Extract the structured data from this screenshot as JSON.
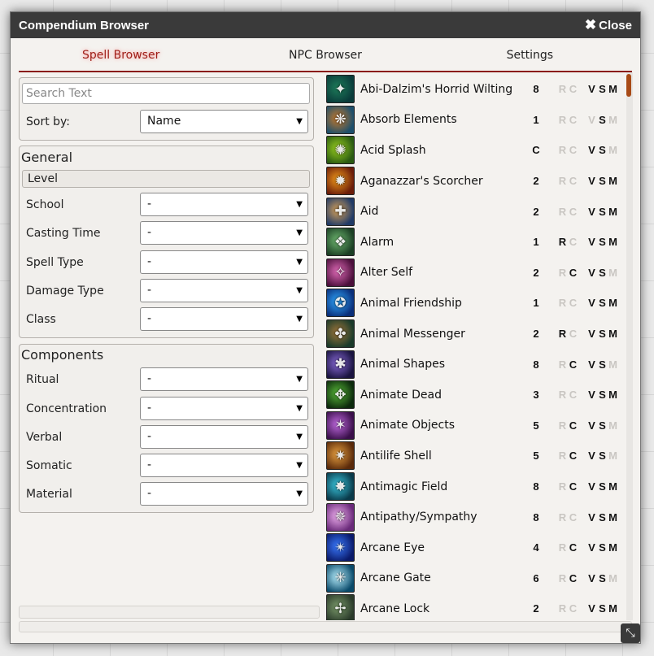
{
  "window": {
    "title": "Compendium Browser",
    "close_label": "Close"
  },
  "tabs": [
    {
      "label": "Spell Browser",
      "active": true
    },
    {
      "label": "NPC Browser",
      "active": false
    },
    {
      "label": "Settings",
      "active": false
    }
  ],
  "search": {
    "placeholder": "Search Text",
    "value": ""
  },
  "sort": {
    "label": "Sort by:",
    "value": "Name"
  },
  "general": {
    "legend": "General",
    "level_label": "Level",
    "filters": [
      {
        "label": "School",
        "value": "-"
      },
      {
        "label": "Casting Time",
        "value": "-"
      },
      {
        "label": "Spell Type",
        "value": "-"
      },
      {
        "label": "Damage Type",
        "value": "-"
      },
      {
        "label": "Class",
        "value": "-"
      }
    ]
  },
  "components": {
    "legend": "Components",
    "filters": [
      {
        "label": "Ritual",
        "value": "-"
      },
      {
        "label": "Concentration",
        "value": "-"
      },
      {
        "label": "Verbal",
        "value": "-"
      },
      {
        "label": "Somatic",
        "value": "-"
      },
      {
        "label": "Material",
        "value": "-"
      }
    ]
  },
  "spells": [
    {
      "name": "Abi-Dalzim's Horrid Wilting",
      "level": "8",
      "r": false,
      "c": false,
      "v": true,
      "s": true,
      "m": true,
      "colors": [
        "#0a3b3a",
        "#1e7d5a"
      ]
    },
    {
      "name": "Absorb Elements",
      "level": "1",
      "r": false,
      "c": false,
      "v": false,
      "s": true,
      "m": false,
      "colors": [
        "#1d4f6b",
        "#c97a2a"
      ]
    },
    {
      "name": "Acid Splash",
      "level": "C",
      "r": false,
      "c": false,
      "v": true,
      "s": true,
      "m": false,
      "colors": [
        "#2a5a12",
        "#9ad01e"
      ]
    },
    {
      "name": "Aganazzar's Scorcher",
      "level": "2",
      "r": false,
      "c": false,
      "v": true,
      "s": true,
      "m": true,
      "colors": [
        "#6b1d0a",
        "#f29a1a"
      ]
    },
    {
      "name": "Aid",
      "level": "2",
      "r": false,
      "c": false,
      "v": true,
      "s": true,
      "m": true,
      "colors": [
        "#203a66",
        "#d9a35a"
      ]
    },
    {
      "name": "Alarm",
      "level": "1",
      "r": true,
      "c": false,
      "v": true,
      "s": true,
      "m": true,
      "colors": [
        "#1b3f24",
        "#6fb870"
      ]
    },
    {
      "name": "Alter Self",
      "level": "2",
      "r": false,
      "c": true,
      "v": true,
      "s": true,
      "m": false,
      "colors": [
        "#4a0f3a",
        "#e06ab8"
      ]
    },
    {
      "name": "Animal Friendship",
      "level": "1",
      "r": false,
      "c": false,
      "v": true,
      "s": true,
      "m": true,
      "colors": [
        "#0a2f7a",
        "#2fa8ff"
      ]
    },
    {
      "name": "Animal Messenger",
      "level": "2",
      "r": true,
      "c": false,
      "v": true,
      "s": true,
      "m": true,
      "colors": [
        "#1a3a2a",
        "#a0763a"
      ]
    },
    {
      "name": "Animal Shapes",
      "level": "8",
      "r": false,
      "c": true,
      "v": true,
      "s": true,
      "m": false,
      "colors": [
        "#1a1440",
        "#8a6ad8"
      ]
    },
    {
      "name": "Animate Dead",
      "level": "3",
      "r": false,
      "c": false,
      "v": true,
      "s": true,
      "m": true,
      "colors": [
        "#0c2a0c",
        "#58b838"
      ]
    },
    {
      "name": "Animate Objects",
      "level": "5",
      "r": false,
      "c": true,
      "v": true,
      "s": true,
      "m": false,
      "colors": [
        "#3a0f4a",
        "#c06ae0"
      ]
    },
    {
      "name": "Antilife Shell",
      "level": "5",
      "r": false,
      "c": true,
      "v": true,
      "s": true,
      "m": false,
      "colors": [
        "#5a2a0a",
        "#e8a040"
      ]
    },
    {
      "name": "Antimagic Field",
      "level": "8",
      "r": false,
      "c": true,
      "v": true,
      "s": true,
      "m": true,
      "colors": [
        "#0a3a4a",
        "#3ac8e0"
      ]
    },
    {
      "name": "Antipathy/Sympathy",
      "level": "8",
      "r": false,
      "c": false,
      "v": true,
      "s": true,
      "m": true,
      "colors": [
        "#6a2a7a",
        "#f0b0f0"
      ]
    },
    {
      "name": "Arcane Eye",
      "level": "4",
      "r": false,
      "c": true,
      "v": true,
      "s": true,
      "m": true,
      "colors": [
        "#0a1a6a",
        "#3a7aff"
      ]
    },
    {
      "name": "Arcane Gate",
      "level": "6",
      "r": false,
      "c": true,
      "v": true,
      "s": true,
      "m": false,
      "colors": [
        "#0a4a6a",
        "#b8f0ff"
      ]
    },
    {
      "name": "Arcane Lock",
      "level": "2",
      "r": false,
      "c": false,
      "v": true,
      "s": true,
      "m": true,
      "colors": [
        "#2a3a2a",
        "#7a9a6a"
      ]
    }
  ]
}
